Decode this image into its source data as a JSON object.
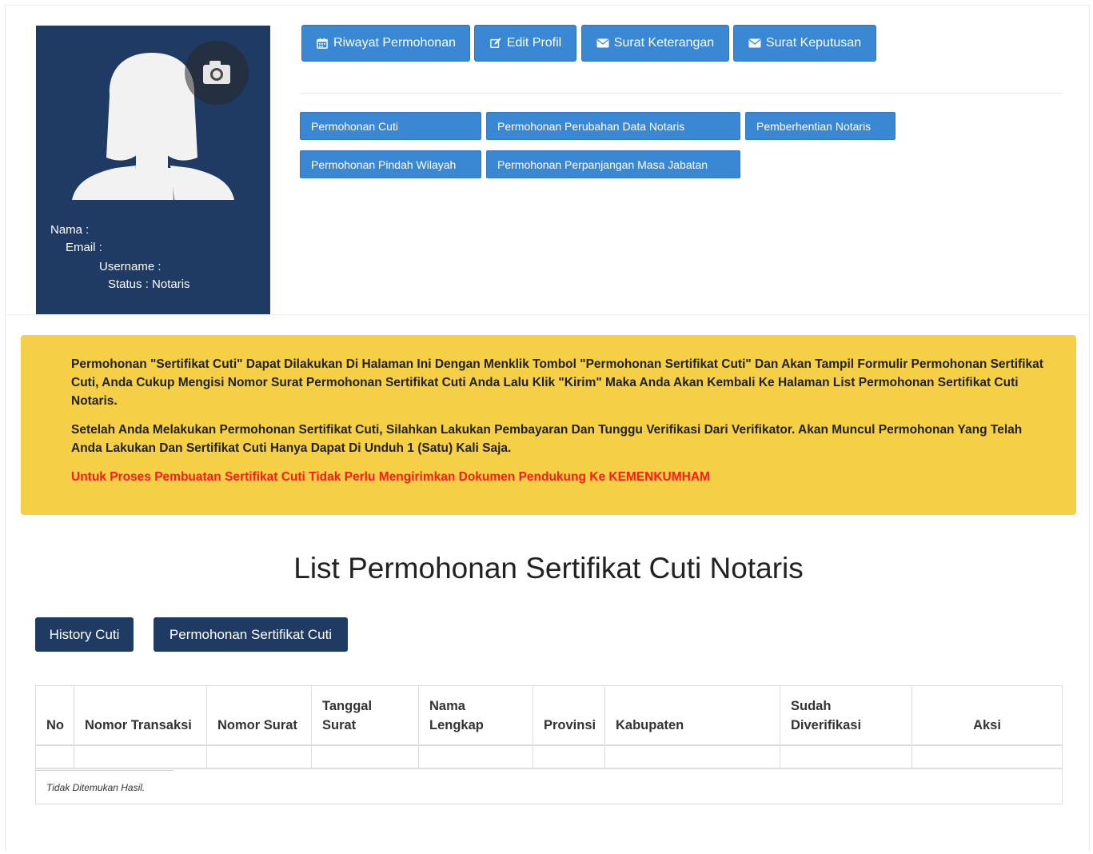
{
  "profile": {
    "labels": {
      "name": "Nama :",
      "email": "Email :",
      "username": "Username :",
      "status": "Status : Notaris"
    }
  },
  "top_buttons": [
    {
      "label": "Riwayat Permohonan",
      "icon": "calendar-icon"
    },
    {
      "label": "Edit Profil",
      "icon": "edit-icon"
    },
    {
      "label": "Surat Keterangan",
      "icon": "envelope-icon"
    },
    {
      "label": "Surat Keputusan",
      "icon": "envelope-icon"
    }
  ],
  "request_buttons": [
    "Permohonan Cuti",
    "Permohonan Perubahan Data Notaris",
    "Pemberhentian Notaris",
    "Permohonan Pindah Wilayah",
    "Permohonan Perpanjangan Masa Jabatan"
  ],
  "alert": {
    "paragraph1": "Permohonan \"Sertifikat Cuti\" Dapat Dilakukan Di Halaman Ini Dengan Menklik Tombol \"Permohonan Sertifikat Cuti\" Dan Akan Tampil Formulir Permohonan Sertifikat Cuti, Anda Cukup Mengisi Nomor Surat Permohonan Sertifikat Cuti Anda Lalu Klik \"Kirim\" Maka Anda Akan Kembali Ke Halaman List Permohonan Sertifikat Cuti Notaris.",
    "paragraph2": "Setelah Anda Melakukan Permohonan Sertifikat Cuti, Silahkan Lakukan Pembayaran Dan Tunggu Verifikasi Dari Verifikator. Akan Muncul Permohonan Yang Telah Anda Lakukan Dan Sertifikat Cuti Hanya Dapat Di Unduh 1 (Satu) Kali Saja.",
    "warning": "Untuk Proses Pembuatan Sertifikat Cuti Tidak Perlu Mengirimkan Dokumen Pendukung Ke KEMENKUMHAM"
  },
  "list": {
    "title": "List Permohonan Sertifikat Cuti Notaris",
    "history_button": "History Cuti",
    "new_request_button": "Permohonan Sertifikat Cuti"
  },
  "table": {
    "headers": [
      "No",
      "Nomor Transaksi",
      "Nomor Surat",
      "Tanggal Surat",
      "Nama Lengkap",
      "Provinsi",
      "Kabupaten",
      "Sudah Diverifikasi",
      "Aksi"
    ],
    "empty_message": "Tidak Ditemukan Hasil."
  },
  "colors": {
    "navy": "#1f3b63",
    "primary_blue": "#3a87d4",
    "alert_yellow": "#f5cf45",
    "warning_red": "#ff1a1a"
  }
}
